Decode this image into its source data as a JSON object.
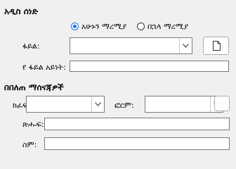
{
  "section_new_document": {
    "title": "አዲስ ሰነድ",
    "radio_now": {
      "label": "አሁኑን ማረሚያ",
      "selected": true
    },
    "radio_later": {
      "label": "በኋላ ማረሚያ",
      "selected": false
    },
    "file_label": "ፋይል:",
    "file_value": "",
    "file_type_label": "የ ፋይል አይነት:",
    "file_type_value": ""
  },
  "section_advanced": {
    "title": "በበለጠ ማሰናጃዎች",
    "row_label": "ክፈፍ:",
    "row_value": "",
    "form_label": "ፎርም:",
    "form_value": "",
    "text_label": "ጽሑፍ:",
    "text_value": "",
    "name_label": "ስም:",
    "name_value": ""
  },
  "icons": {
    "new_file": "file-icon",
    "dropdown": "chevron-down-icon"
  }
}
